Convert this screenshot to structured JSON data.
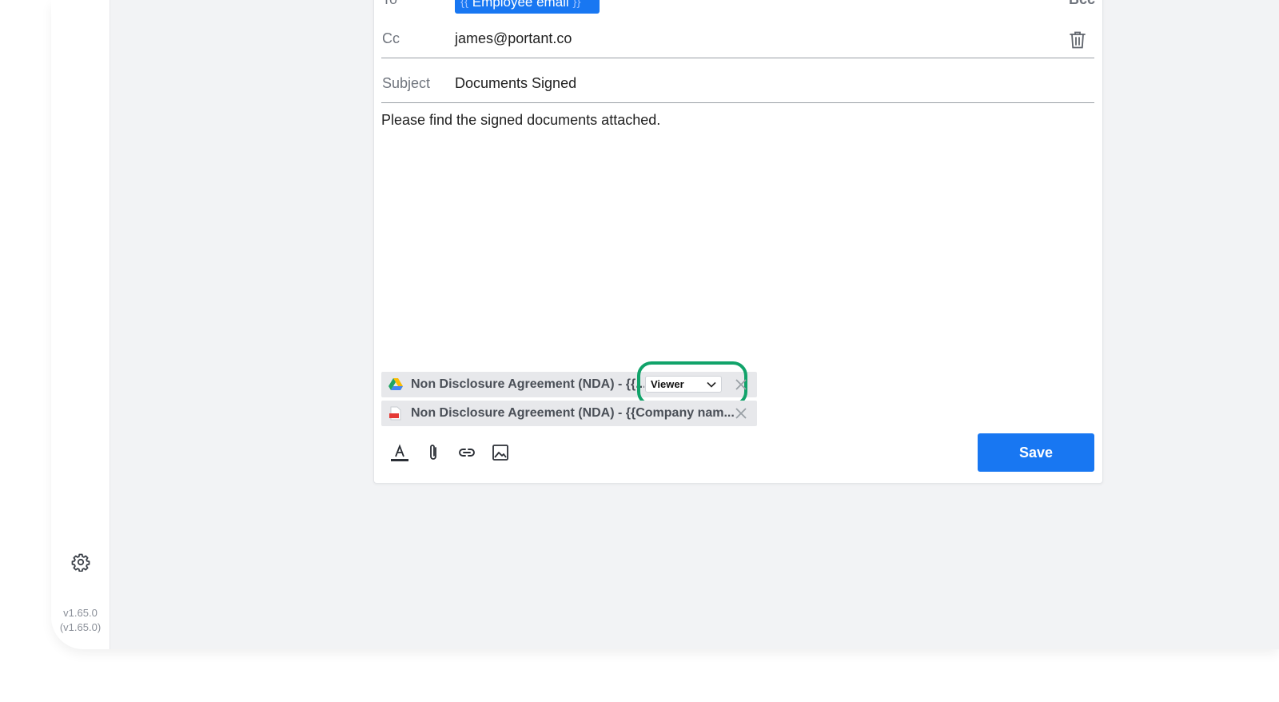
{
  "sidebar": {
    "version_line1": "v1.65.0",
    "version_line2": "(v1.65.0)"
  },
  "email": {
    "to_label": "To",
    "to_chip": {
      "open": "{{",
      "text": "Employee email",
      "close": "}}"
    },
    "bcc_label": "Bcc",
    "cc_label": "Cc",
    "cc_value": "james@portant.co",
    "subject_label": "Subject",
    "subject_value": "Documents Signed",
    "body": "Please find the signed documents attached."
  },
  "attachments": [
    {
      "name": "Non Disclosure Agreement (NDA) - {{...",
      "source_icon": "google-drive-icon",
      "permission": "Viewer"
    },
    {
      "name": "Non Disclosure Agreement (NDA) - {{Company nam...",
      "source_icon": "pdf-icon"
    }
  ],
  "toolbar": {
    "tools": [
      "text-format-icon",
      "attachment-icon",
      "link-icon",
      "image-icon"
    ],
    "save_label": "Save"
  },
  "colors": {
    "accent": "#1877f2",
    "highlight": "#11a36a",
    "background": "#f2f3f5"
  }
}
